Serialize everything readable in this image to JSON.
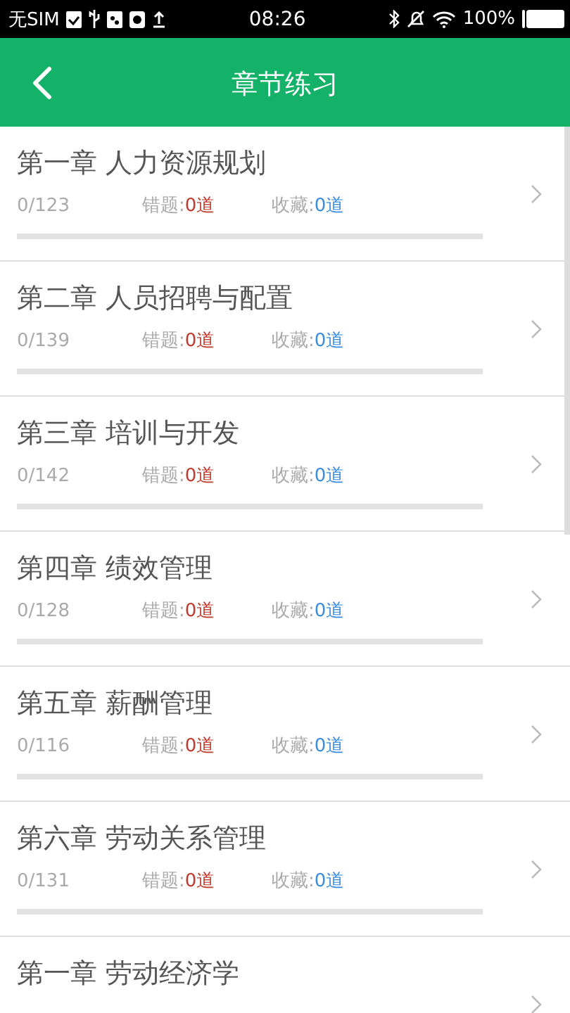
{
  "status_bar": {
    "carrier": "无SIM",
    "time": "08:26",
    "battery": "100%"
  },
  "header": {
    "title": "章节练习"
  },
  "chapters": [
    {
      "title": "第一章 人力资源规划",
      "progress": "0/123",
      "wrong_label": "错题:",
      "wrong_count": "0道",
      "fav_label": "收藏:",
      "fav_count": "0道",
      "level": 0
    },
    {
      "title": "第二章 人员招聘与配置",
      "progress": "0/139",
      "wrong_label": "错题:",
      "wrong_count": "0道",
      "fav_label": "收藏:",
      "fav_count": "0道",
      "level": 0
    },
    {
      "title": "第三章 培训与开发",
      "progress": "0/142",
      "wrong_label": "错题:",
      "wrong_count": "0道",
      "fav_label": "收藏:",
      "fav_count": "0道",
      "level": 0
    },
    {
      "title": "第四章 绩效管理",
      "progress": "0/128",
      "wrong_label": "错题:",
      "wrong_count": "0道",
      "fav_label": "收藏:",
      "fav_count": "0道",
      "level": 0
    },
    {
      "title": "第五章 薪酬管理",
      "progress": "0/116",
      "wrong_label": "错题:",
      "wrong_count": "0道",
      "fav_label": "收藏:",
      "fav_count": "0道",
      "level": 0
    },
    {
      "title": "第六章 劳动关系管理",
      "progress": "0/131",
      "wrong_label": "错题:",
      "wrong_count": "0道",
      "fav_label": "收藏:",
      "fav_count": "0道",
      "level": 0
    },
    {
      "title": "第一章 劳动经济学"
    }
  ]
}
